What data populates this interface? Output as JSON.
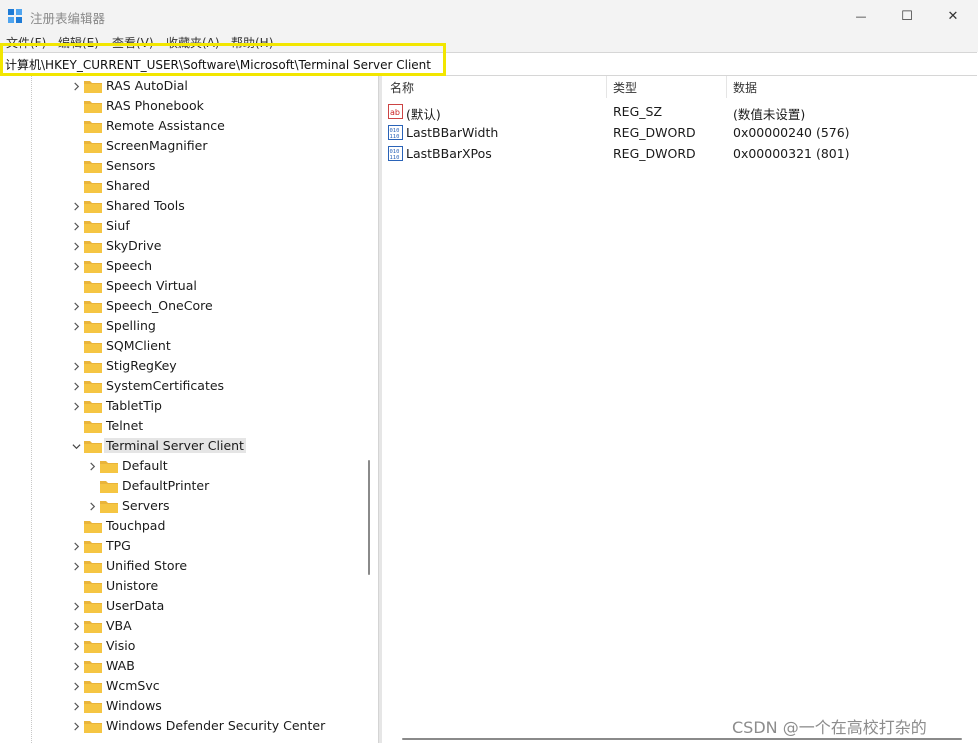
{
  "window": {
    "title": "注册表编辑器",
    "minimize_glyph": "—",
    "maximize_glyph": "☐",
    "close_glyph": "✕",
    "icon": "registry-editor-icon"
  },
  "menu": [
    "文件(F)",
    "编辑(E)",
    "查看(V)",
    "收藏夹(A)",
    "帮助(H)"
  ],
  "address": {
    "path": "计算机\\HKEY_CURRENT_USER\\Software\\Microsoft\\Terminal Server Client"
  },
  "tree": [
    {
      "label": "RAS AutoDial",
      "level": 1,
      "expander": "collapsed"
    },
    {
      "label": "RAS Phonebook",
      "level": 1,
      "expander": "none"
    },
    {
      "label": "Remote Assistance",
      "level": 1,
      "expander": "none"
    },
    {
      "label": "ScreenMagnifier",
      "level": 1,
      "expander": "none"
    },
    {
      "label": "Sensors",
      "level": 1,
      "expander": "none"
    },
    {
      "label": "Shared",
      "level": 1,
      "expander": "none"
    },
    {
      "label": "Shared Tools",
      "level": 1,
      "expander": "collapsed"
    },
    {
      "label": "Siuf",
      "level": 1,
      "expander": "collapsed"
    },
    {
      "label": "SkyDrive",
      "level": 1,
      "expander": "collapsed"
    },
    {
      "label": "Speech",
      "level": 1,
      "expander": "collapsed"
    },
    {
      "label": "Speech Virtual",
      "level": 1,
      "expander": "none"
    },
    {
      "label": "Speech_OneCore",
      "level": 1,
      "expander": "collapsed"
    },
    {
      "label": "Spelling",
      "level": 1,
      "expander": "collapsed"
    },
    {
      "label": "SQMClient",
      "level": 1,
      "expander": "none"
    },
    {
      "label": "StigRegKey",
      "level": 1,
      "expander": "collapsed"
    },
    {
      "label": "SystemCertificates",
      "level": 1,
      "expander": "collapsed"
    },
    {
      "label": "TabletTip",
      "level": 1,
      "expander": "collapsed"
    },
    {
      "label": "Telnet",
      "level": 1,
      "expander": "none"
    },
    {
      "label": "Terminal Server Client",
      "level": 1,
      "expander": "expanded",
      "selected": true
    },
    {
      "label": "Default",
      "level": 2,
      "expander": "collapsed"
    },
    {
      "label": "DefaultPrinter",
      "level": 2,
      "expander": "none"
    },
    {
      "label": "Servers",
      "level": 2,
      "expander": "collapsed"
    },
    {
      "label": "Touchpad",
      "level": 1,
      "expander": "none"
    },
    {
      "label": "TPG",
      "level": 1,
      "expander": "collapsed"
    },
    {
      "label": "Unified Store",
      "level": 1,
      "expander": "collapsed"
    },
    {
      "label": "Unistore",
      "level": 1,
      "expander": "none"
    },
    {
      "label": "UserData",
      "level": 1,
      "expander": "collapsed"
    },
    {
      "label": "VBA",
      "level": 1,
      "expander": "collapsed"
    },
    {
      "label": "Visio",
      "level": 1,
      "expander": "collapsed"
    },
    {
      "label": "WAB",
      "level": 1,
      "expander": "collapsed"
    },
    {
      "label": "WcmSvc",
      "level": 1,
      "expander": "collapsed"
    },
    {
      "label": "Windows",
      "level": 1,
      "expander": "collapsed"
    },
    {
      "label": "Windows Defender Security Center",
      "level": 1,
      "expander": "collapsed"
    }
  ],
  "values_table": {
    "columns": [
      "名称",
      "类型",
      "数据"
    ],
    "rows": [
      {
        "name": "(默认)",
        "type": "REG_SZ",
        "data": "(数值未设置)",
        "icon": "string-value-icon"
      },
      {
        "name": "LastBBarWidth",
        "type": "REG_DWORD",
        "data": "0x00000240 (576)",
        "icon": "binary-value-icon"
      },
      {
        "name": "LastBBarXPos",
        "type": "REG_DWORD",
        "data": "0x00000321 (801)",
        "icon": "binary-value-icon"
      }
    ]
  },
  "watermark": "CSDN @一个在高校打杂的",
  "colors": {
    "highlight": "#f2e600",
    "folder": "#f5c542",
    "selected_bg": "#e5e5e5"
  }
}
